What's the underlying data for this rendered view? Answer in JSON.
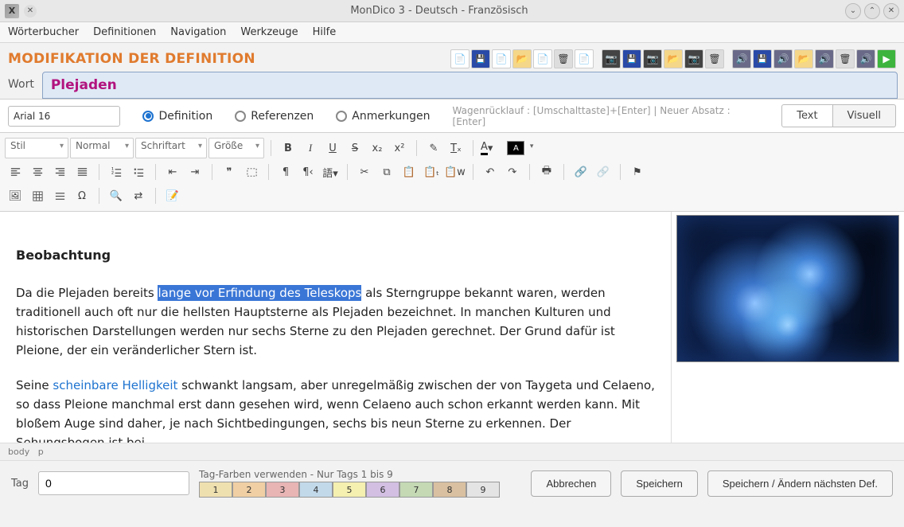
{
  "window": {
    "title": "MonDico 3 - Deutsch - Französisch",
    "app_icon_letter": "X"
  },
  "menu": {
    "items": [
      "Wörterbucher",
      "Definitionen",
      "Navigation",
      "Werkzeuge",
      "Hilfe"
    ]
  },
  "header": {
    "section_title": "MODIFIKATION DER DEFINITION"
  },
  "word": {
    "label": "Wort",
    "value": "Plejaden"
  },
  "view_radios": {
    "definition": "Definition",
    "referenzen": "Referenzen",
    "anmerkungen": "Anmerkungen",
    "selected": "definition"
  },
  "font_field": "Arial 16",
  "hint_text": "Wagenrücklauf : [Umschalttaste]+[Enter] | Neuer Absatz : [Enter]",
  "view_buttons": {
    "text": "Text",
    "visual": "Visuell",
    "active": "text"
  },
  "ck_dropdowns": {
    "style": "Stil",
    "format": "Normal",
    "font": "Schriftart",
    "size": "Größe"
  },
  "editor": {
    "heading": "Beobachtung",
    "p1_pre": "Da die Plejaden bereits ",
    "p1_hl": "lange vor Erfindung des Teleskops",
    "p1_post": " als Sterngruppe bekannt waren, werden traditionell auch oft nur die hellsten Hauptsterne als Plejaden bezeichnet. In manchen Kulturen und historischen Darstellungen werden nur sechs Sterne zu den Plejaden gerechnet. Der Grund dafür ist Pleione, der ein veränderlicher Stern ist.",
    "p2_pre": "Seine ",
    "p2_link": "scheinbare Helligkeit",
    "p2_post": " schwankt langsam, aber unregelmäßig zwischen der von Taygeta und Celaeno, so dass Pleione manchmal erst dann gesehen wird, wenn Celaeno auch schon erkannt werden kann. Mit bloßem Auge sind daher, je nach Sichtbedingungen, sechs bis neun Sterne zu erkennen. Der Sehungsbogen ist bei"
  },
  "path": {
    "body": "body",
    "p": "p"
  },
  "tags": {
    "label": "Tag",
    "value": "0",
    "caption": "Tag-Farben verwenden - Nur Tags 1 bis 9",
    "numbers": [
      "1",
      "2",
      "3",
      "4",
      "5",
      "6",
      "7",
      "8",
      "9"
    ]
  },
  "buttons": {
    "cancel": "Abbrechen",
    "save": "Speichern",
    "save_next": "Speichern / Ändern nächsten Def."
  }
}
